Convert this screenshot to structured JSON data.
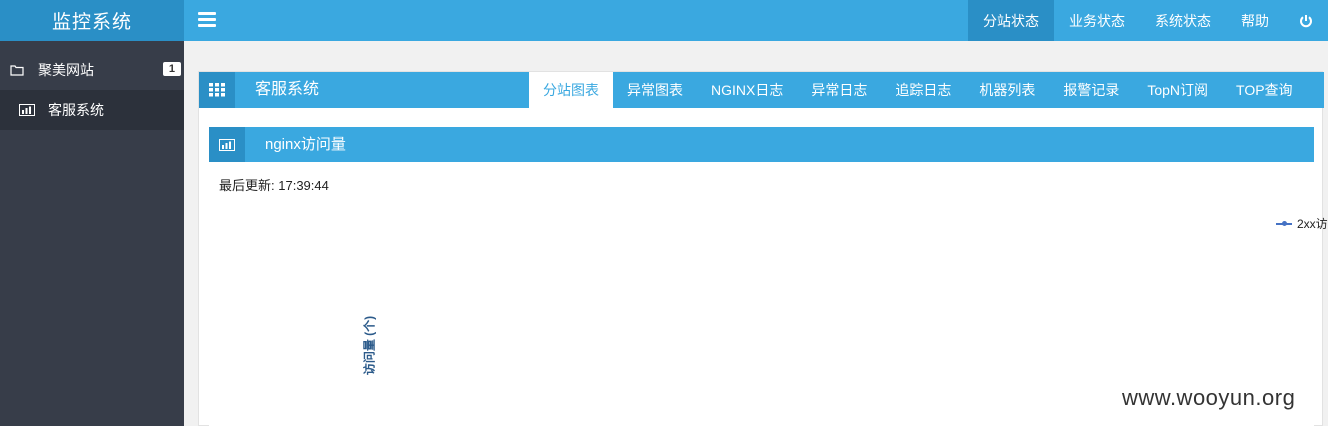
{
  "app": {
    "title": "监控系统"
  },
  "topnav": {
    "items": [
      "分站状态",
      "业务状态",
      "系统状态",
      "帮助"
    ],
    "active_index": 0
  },
  "sidebar": {
    "items": [
      {
        "label": "聚美网站",
        "icon": "folder-icon",
        "badge": "1"
      },
      {
        "label": "客服系统",
        "icon": "chart-bar-icon"
      }
    ]
  },
  "panel": {
    "title": "客服系统",
    "tabs": [
      "分站图表",
      "异常图表",
      "NGINX日志",
      "异常日志",
      "追踪日志",
      "机器列表",
      "报警记录",
      "TopN订阅",
      "TOP查询"
    ],
    "active_tab": 0
  },
  "chart_panel": {
    "title": "nginx访问量",
    "updated_label": "最后更新:",
    "updated_time": "17:39:44"
  },
  "chart_data": {
    "type": "line",
    "title": "",
    "ylabel": "访问量 (个)",
    "series": [
      {
        "name": "2xx访"
      }
    ]
  },
  "watermark": "www.wooyun.org",
  "colors": {
    "accent": "#3aa8e0",
    "accent_dark": "#2a8fc6",
    "sidebar": "#373d49",
    "series": "#4572c4"
  }
}
